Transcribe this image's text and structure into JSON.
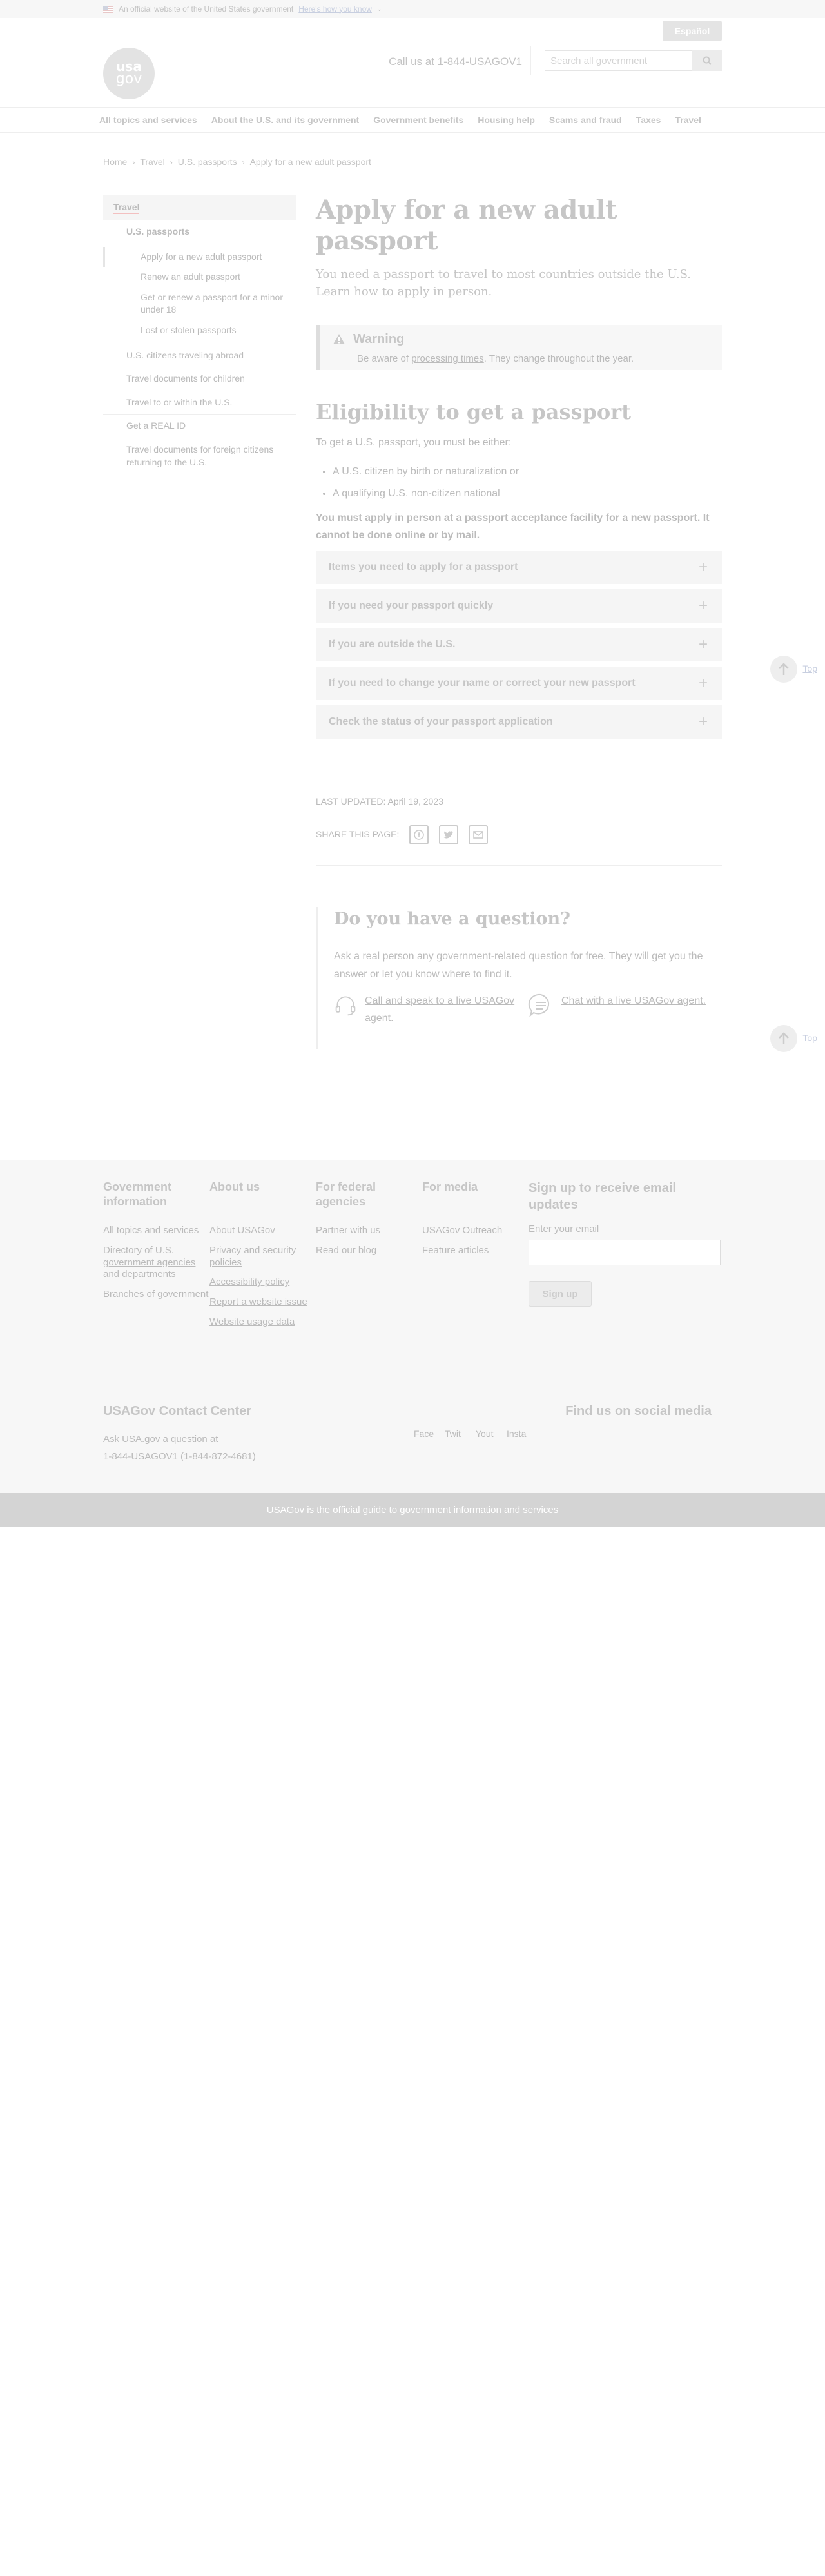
{
  "banner": {
    "official": "An official website of the United States government",
    "how_know": "Here's how you know"
  },
  "header": {
    "espanol": "Español",
    "call_us": "Call us at 1-844-USAGOV1",
    "search_placeholder": "Search all government",
    "logo_line1": "usa",
    "logo_line2": "gov"
  },
  "nav": {
    "items": [
      "All topics and services",
      "About the U.S. and its government",
      "Government benefits",
      "Housing help",
      "Scams and fraud",
      "Taxes",
      "Travel"
    ]
  },
  "breadcrumb": {
    "items": [
      "Home",
      "Travel",
      "U.S. passports"
    ],
    "current": "Apply for a new adult passport"
  },
  "sidenav": {
    "top": "Travel",
    "section": "U.S. passports",
    "subitems": [
      "Apply for a new adult passport",
      "Renew an adult passport",
      "Get or renew a passport for a minor under 18",
      "Lost or stolen passports"
    ],
    "items": [
      "U.S. citizens traveling abroad",
      "Travel documents for children",
      "Travel to or within the U.S.",
      "Get a REAL ID",
      "Travel documents for foreign citizens returning to the U.S."
    ]
  },
  "main": {
    "title": "Apply for a new adult passport",
    "intro": "You need a passport to travel to most countries outside the U.S. Learn how to apply in person.",
    "warning_title": "Warning",
    "warning_pre": "Be aware of ",
    "warning_link": "processing times",
    "warning_post": ". They change throughout the year.",
    "h2": "Eligibility to get a passport",
    "p1": "To get a U.S. passport, you must be either:",
    "bullets": [
      "A U.S. citizen by birth or naturalization or",
      "A qualifying U.S. non-citizen national"
    ],
    "bold_pre": "You must apply in person at a ",
    "bold_link": "passport acceptance facility",
    "bold_post": " for a new passport. It cannot be done online or by mail.",
    "accordion": [
      "Items you need to apply for a passport",
      "If you need your passport quickly",
      "If you are outside the U.S.",
      "If you need to change your name or correct your new passport",
      "Check the status of your passport application"
    ],
    "updated": "LAST UPDATED: April 19, 2023",
    "share_label": "SHARE THIS PAGE:"
  },
  "question": {
    "title": "Do you have a question?",
    "text": "Ask a real person any government-related question for free. They will get you the answer or let you know where to find it.",
    "call": "Call and speak to a live USAGov agent.",
    "chat": "Chat with a live USAGov agent."
  },
  "top_label": "Top",
  "footer": {
    "col1": {
      "title": "Government information",
      "links": [
        "All topics and services",
        "Directory of U.S. government agencies and departments",
        "Branches of government"
      ]
    },
    "col2": {
      "title": "About us",
      "links": [
        "About USAGov",
        "Privacy and security policies",
        "Accessibility policy",
        "Report a website issue",
        "Website usage data"
      ]
    },
    "col3": {
      "title": "For federal agencies",
      "links": [
        "Partner with us",
        "Read our blog"
      ]
    },
    "col4": {
      "title": "For media",
      "links": [
        "USAGov Outreach",
        "Feature articles"
      ]
    },
    "signup_title": "Sign up to receive email updates",
    "email_label": "Enter your email",
    "signup_button": "Sign up",
    "contact_title": "USAGov Contact Center",
    "contact_line1": "Ask USA.gov a question at",
    "contact_line2": "1-844-USAGOV1 (1-844-872-4681)",
    "social_title": "Find us on social media",
    "social": [
      "Face",
      "Twit",
      "Yout",
      "Insta"
    ],
    "bottom": "USAGov is the official guide to government information and services"
  }
}
